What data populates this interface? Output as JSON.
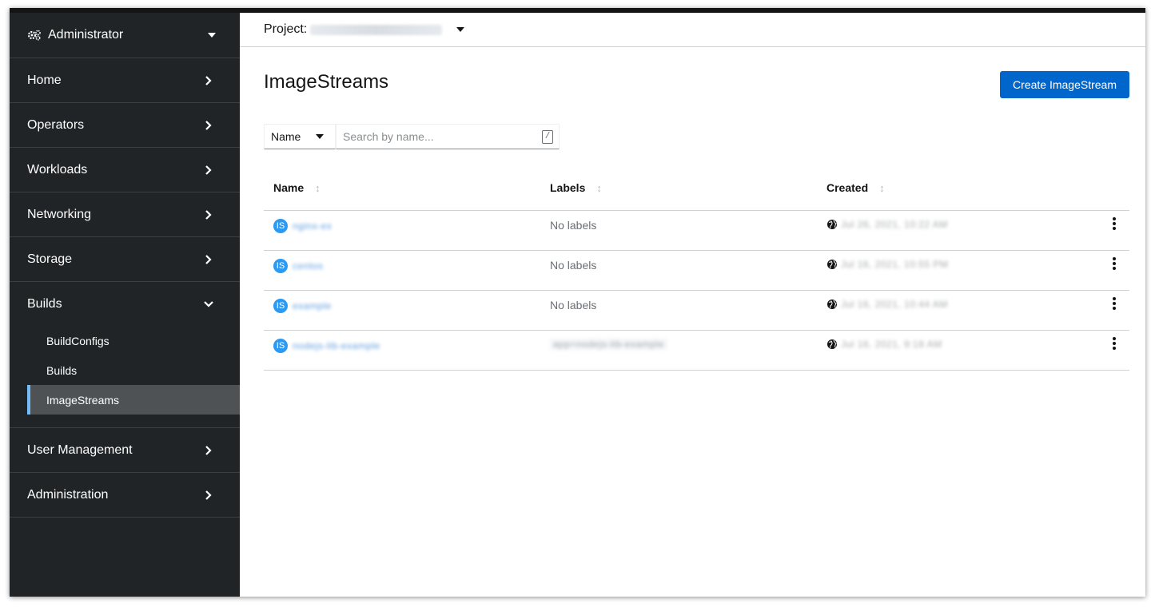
{
  "sidebar": {
    "perspective": "Administrator",
    "items": [
      {
        "label": "Home"
      },
      {
        "label": "Operators"
      },
      {
        "label": "Workloads"
      },
      {
        "label": "Networking"
      },
      {
        "label": "Storage"
      },
      {
        "label": "Builds"
      },
      {
        "label": "User Management"
      },
      {
        "label": "Administration"
      }
    ],
    "builds_subitems": [
      {
        "label": "BuildConfigs"
      },
      {
        "label": "Builds"
      },
      {
        "label": "ImageStreams"
      }
    ]
  },
  "projectbar": {
    "label": "Project:"
  },
  "page": {
    "title": "ImageStreams",
    "create_button": "Create ImageStream"
  },
  "filter": {
    "select_value": "Name",
    "placeholder": "Search by name...",
    "shortcut": "/"
  },
  "table": {
    "columns": [
      "Name",
      "Labels",
      "Created"
    ],
    "badge": "IS",
    "rows": [
      {
        "name": "nginx-ex",
        "labels": "No labels",
        "created": "Jul 26, 2021, 10:22 AM"
      },
      {
        "name": "centos",
        "labels": "No labels",
        "created": "Jul 16, 2021, 10:55 PM"
      },
      {
        "name": "example",
        "labels": "No labels",
        "created": "Jul 16, 2021, 10:44 AM"
      },
      {
        "name": "nodejs-lib-example",
        "labels": "app=nodejs-lib-example",
        "created": "Jul 16, 2021, 9:18 AM"
      }
    ]
  },
  "colors": {
    "accent": "#0066cc",
    "sidebar_bg": "#212427",
    "active_indicator": "#73bcf7"
  }
}
